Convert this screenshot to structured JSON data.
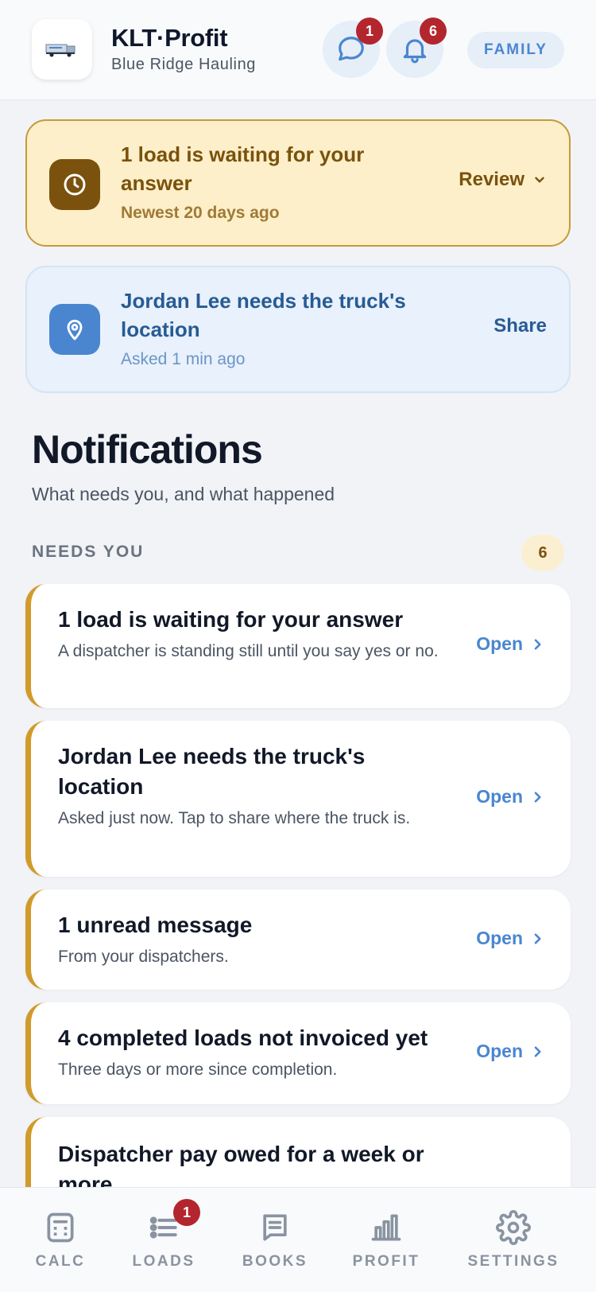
{
  "header": {
    "app_title": "KLT·Profit",
    "company": "Blue Ridge Hauling",
    "messages_count": "1",
    "alerts_count": "6",
    "role_pill": "FAMILY",
    "icons": {
      "logo": "truck-logo",
      "messages": "chat-bubble-icon",
      "alerts": "bell-icon"
    }
  },
  "banners": {
    "pending": {
      "title": "1 load is waiting for your answer",
      "subtitle": "Newest 20 days ago",
      "action": "Review",
      "icon": "clock-icon"
    },
    "location": {
      "title": "Jordan Lee needs the truck's location",
      "subtitle": "Asked 1 min ago",
      "action": "Share",
      "icon": "map-pin-icon"
    }
  },
  "notifications": {
    "title": "Notifications",
    "subtitle": "What needs you, and what happened",
    "section_label": "NEEDS YOU",
    "section_count": "6",
    "open_label": "Open",
    "items": [
      {
        "title": "1 load is waiting for your answer",
        "desc": "A dispatcher is standing still until you say yes or no."
      },
      {
        "title": "Jordan Lee needs the truck's location",
        "desc": "Asked just now. Tap to share where the truck is."
      },
      {
        "title": "1 unread message",
        "desc": "From your dispatchers."
      },
      {
        "title": "4 completed loads not invoiced yet",
        "desc": "Three days or more since completion."
      },
      {
        "title": "Dispatcher pay owed for a week or more",
        "desc": ""
      }
    ]
  },
  "nav": {
    "items": [
      {
        "label": "CALC",
        "icon": "calculator-icon"
      },
      {
        "label": "LOADS",
        "icon": "list-icon",
        "badge": "1"
      },
      {
        "label": "BOOKS",
        "icon": "book-icon"
      },
      {
        "label": "PROFIT",
        "icon": "bar-chart-icon"
      },
      {
        "label": "SETTINGS",
        "icon": "gear-icon"
      }
    ]
  },
  "colors": {
    "accent": "#4a86d0",
    "amber_text": "#7a520d",
    "amber_bg": "#fcefc9",
    "badge_red": "#b3262e",
    "card_stripe": "#d19a2a"
  }
}
